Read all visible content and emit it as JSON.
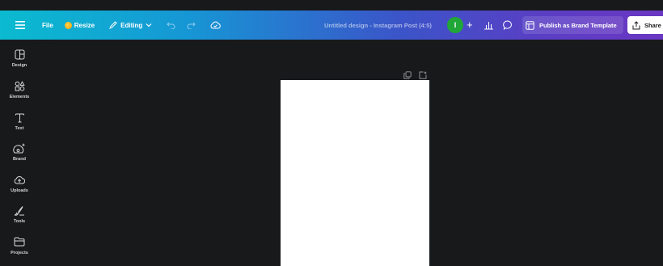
{
  "topbar": {
    "file_label": "File",
    "resize_label": "Resize",
    "editing_label": "Editing",
    "doc_title": "Untitled design - Instagram Post (4:5)",
    "avatar_initial": "I",
    "plus_label": "+",
    "publish_label": "Publish as Brand Template",
    "share_label": "Share"
  },
  "sidebar": {
    "items": [
      {
        "label": "Design",
        "icon": "design-icon"
      },
      {
        "label": "Elements",
        "icon": "elements-icon"
      },
      {
        "label": "Text",
        "icon": "text-icon"
      },
      {
        "label": "Brand",
        "icon": "brand-icon"
      },
      {
        "label": "Uploads",
        "icon": "uploads-icon"
      },
      {
        "label": "Tools",
        "icon": "tools-icon"
      },
      {
        "label": "Projects",
        "icon": "projects-icon"
      }
    ]
  },
  "colors": {
    "gradient_start": "#0bbbd0",
    "gradient_end": "#6a37c3",
    "background": "#18191b",
    "avatar": "#21a638"
  }
}
